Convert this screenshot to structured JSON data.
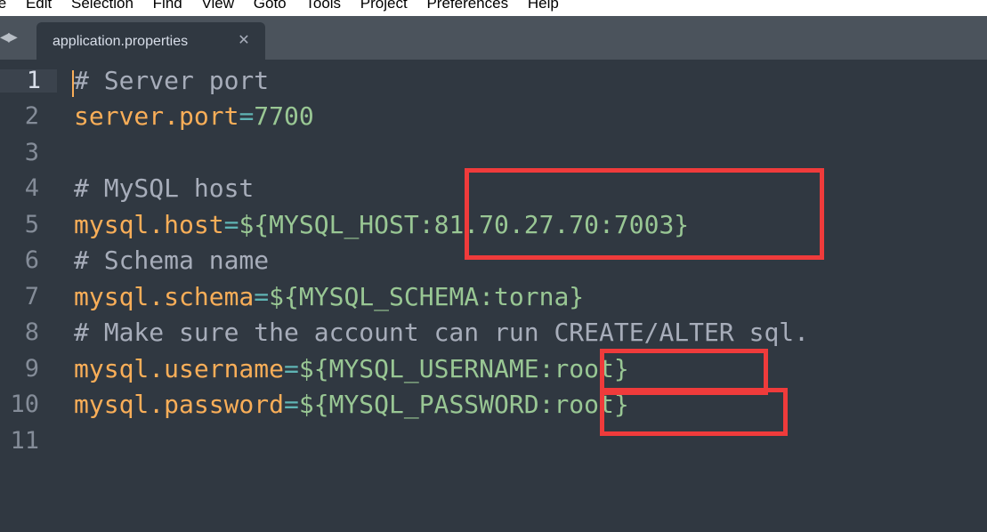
{
  "menubar": {
    "items": [
      "le",
      "Edit",
      "Selection",
      "Find",
      "View",
      "Goto",
      "Tools",
      "Project",
      "Preferences",
      "Help"
    ]
  },
  "tabbar": {
    "nav_left_icon": "triangle-left",
    "nav_right_icon": "triangle-right",
    "active_tab": {
      "label": "application.properties",
      "close_icon": "close-x"
    }
  },
  "editor": {
    "active_line": 1,
    "lines": [
      {
        "num": "1",
        "comment": "# Server port"
      },
      {
        "num": "2",
        "key": "server.port",
        "eq": "=",
        "value": "7700"
      },
      {
        "num": "3"
      },
      {
        "num": "4",
        "comment": "# MySQL host"
      },
      {
        "num": "5",
        "key": "mysql.host",
        "eq": "=",
        "value": "${MYSQL_HOST:81.70.27.70:7003}"
      },
      {
        "num": "6",
        "comment": "# Schema name"
      },
      {
        "num": "7",
        "key": "mysql.schema",
        "eq": "=",
        "value": "${MYSQL_SCHEMA:torna}"
      },
      {
        "num": "8",
        "comment": "# Make sure the account can run CREATE/ALTER sql."
      },
      {
        "num": "9",
        "key": "mysql.username",
        "eq": "=",
        "value": "${MYSQL_USERNAME:root}"
      },
      {
        "num": "10",
        "key": "mysql.password",
        "eq": "=",
        "value": "${MYSQL_PASSWORD:root}"
      },
      {
        "num": "11"
      }
    ]
  },
  "colors": {
    "background": "#303841",
    "tabbar": "#4b535c",
    "key": "#f9ae58",
    "value": "#99c794",
    "equals": "#5fb4b4",
    "comment": "#a7adba",
    "highlight_box": "#ef3b3b"
  }
}
